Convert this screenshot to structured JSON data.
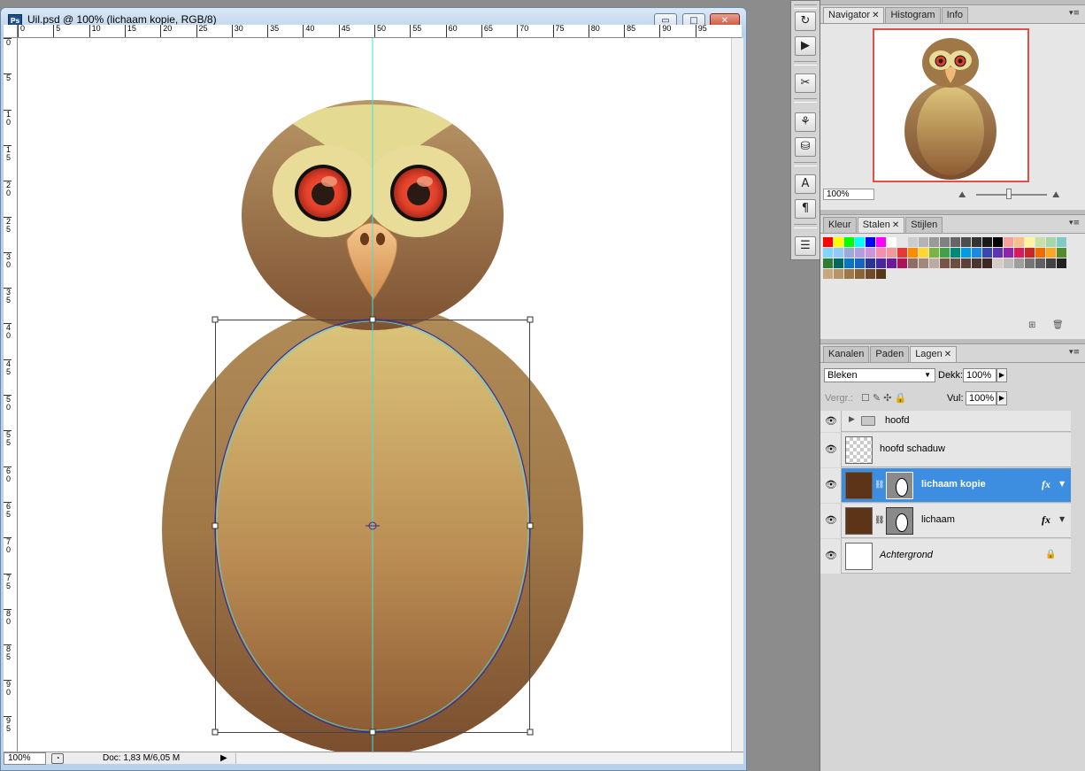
{
  "document": {
    "title": "Uil.psd @ 100% (lichaam kopie, RGB/8)",
    "app_icon": "Ps",
    "window_buttons": {
      "minimize": "▭",
      "maximize": "□",
      "close": "✕"
    },
    "ruler_h_labels": [
      "0",
      "5",
      "10",
      "15",
      "20",
      "25",
      "30",
      "35",
      "40",
      "45",
      "50",
      "55",
      "60",
      "65",
      "70",
      "75",
      "80",
      "85",
      "90",
      "95"
    ],
    "ruler_v_labels": [
      "0",
      "5",
      "10",
      "15",
      "20",
      "25",
      "30",
      "35",
      "40",
      "45",
      "50",
      "55",
      "60",
      "65",
      "70",
      "75",
      "80",
      "85",
      "90",
      "95"
    ],
    "status": {
      "zoom": "100%",
      "doc_size": "Doc: 1,83 M/6,05 M",
      "arrow": "▶"
    }
  },
  "navigator_panel": {
    "tabs": [
      {
        "label": "Navigator",
        "active": true,
        "closable": true
      },
      {
        "label": "Histogram",
        "active": false,
        "closable": false
      },
      {
        "label": "Info",
        "active": false,
        "closable": false
      }
    ],
    "zoom": "100%",
    "zoom_level": 0.45
  },
  "swatches_panel": {
    "tabs": [
      {
        "label": "Kleur",
        "active": false,
        "closable": false
      },
      {
        "label": "Stalen",
        "active": true,
        "closable": true
      },
      {
        "label": "Stijlen",
        "active": false,
        "closable": false
      }
    ],
    "colors": [
      "#ff0000",
      "#ffff00",
      "#00ff00",
      "#00ffff",
      "#0000ff",
      "#ff00ff",
      "#ffffff",
      "#e6e6e6",
      "#cccccc",
      "#b3b3b3",
      "#999999",
      "#808080",
      "#666666",
      "#4d4d4d",
      "#333333",
      "#1a1a1a",
      "#000000",
      "#f5a09a",
      "#f7c08a",
      "#fff59d",
      "#c5e1a5",
      "#a5d6a7",
      "#80cbc4",
      "#81d4fa",
      "#90caf9",
      "#9fa8da",
      "#b39ddb",
      "#ce93d8",
      "#f48fb1",
      "#ef9a9a",
      "#e53935",
      "#fb8c00",
      "#fdd835",
      "#7cb342",
      "#43a047",
      "#00897b",
      "#039be5",
      "#1e88e5",
      "#3949ab",
      "#5e35b1",
      "#8e24aa",
      "#d81b60",
      "#c62828",
      "#ef6c00",
      "#f9a825",
      "#558b2f",
      "#2e7d32",
      "#00695c",
      "#0277bd",
      "#1565c0",
      "#283593",
      "#4527a0",
      "#6a1b9a",
      "#ad1457",
      "#8d6e63",
      "#a1887f",
      "#bcaaa4",
      "#795548",
      "#6d4c41",
      "#5d4037",
      "#4e342e",
      "#3e2723",
      "#d7ccc8",
      "#bdbdbd",
      "#9e9e9e",
      "#757575",
      "#616161",
      "#424242",
      "#212121",
      "#c8a882",
      "#b89468",
      "#a07848",
      "#8a6238",
      "#6e4a28",
      "#563818"
    ],
    "icons": {
      "new": "new-swatch-icon",
      "delete": "trash-icon"
    }
  },
  "layers_panel": {
    "tabs": [
      {
        "label": "Kanalen",
        "active": false,
        "closable": false
      },
      {
        "label": "Paden",
        "active": false,
        "closable": false
      },
      {
        "label": "Lagen",
        "active": true,
        "closable": true
      }
    ],
    "blend_mode": "Bleken",
    "opacity_label": "Dekk:",
    "opacity": "100%",
    "lock_label": "Vergr.:",
    "fill_label": "Vul:",
    "fill": "100%",
    "layers": [
      {
        "name": "hoofd",
        "type": "group",
        "selected": false
      },
      {
        "name": "hoofd schaduw",
        "type": "transparent",
        "selected": false
      },
      {
        "name": "lichaam kopie",
        "type": "masked",
        "selected": true,
        "fx": "fx"
      },
      {
        "name": "lichaam",
        "type": "masked",
        "selected": false,
        "fx": "fx"
      },
      {
        "name": "Achtergrond",
        "type": "background",
        "selected": false,
        "locked": true
      }
    ]
  },
  "colors": {
    "window_frame": "#b9d1ea",
    "selection": "#3d8ee0",
    "owl_light": "#d8c074",
    "owl_dark": "#8a5a34",
    "guide": "#40e0e0",
    "path": "#3a2a9a"
  }
}
